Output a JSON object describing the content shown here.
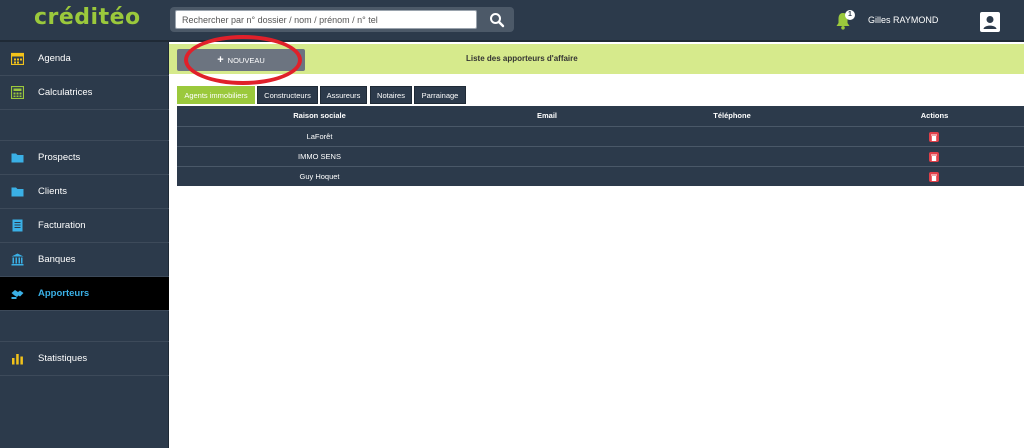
{
  "header": {
    "logo": "créditéo",
    "search_placeholder": "Rechercher par n° dossier / nom / prénom / n° tel",
    "notification_count": "1",
    "username": "Gilles RAYMOND"
  },
  "sidebar": {
    "items": [
      {
        "label": "Agenda",
        "icon": "calendar-icon"
      },
      {
        "label": "Calculatrices",
        "icon": "calculator-icon"
      },
      {
        "label": "Prospects",
        "icon": "folder-icon"
      },
      {
        "label": "Clients",
        "icon": "folder-icon"
      },
      {
        "label": "Facturation",
        "icon": "invoice-icon"
      },
      {
        "label": "Banques",
        "icon": "bank-icon"
      },
      {
        "label": "Apporteurs",
        "icon": "handshake-icon",
        "active": true
      },
      {
        "label": "Statistiques",
        "icon": "bar-chart-icon"
      }
    ]
  },
  "toolbar": {
    "new_label": "NOUVEAU",
    "title": "Liste des apporteurs d'affaire"
  },
  "tabs": [
    {
      "label": "Agents immobiliers",
      "active": true
    },
    {
      "label": "Constructeurs"
    },
    {
      "label": "Assureurs"
    },
    {
      "label": "Notaires"
    },
    {
      "label": "Parrainage"
    }
  ],
  "table": {
    "columns": [
      "Raison sociale",
      "Email",
      "Téléphone",
      "Actions"
    ],
    "rows": [
      {
        "raison_sociale": "LaForêt",
        "email": "",
        "telephone": ""
      },
      {
        "raison_sociale": "IMMO SENS",
        "email": "",
        "telephone": ""
      },
      {
        "raison_sociale": "Guy Hoquet",
        "email": "",
        "telephone": ""
      }
    ]
  },
  "colors": {
    "header_bg": "#2c3a4b",
    "accent_green": "#9bc93c",
    "toolbar_bg": "#d6ea8c",
    "active_link": "#3ab0e6",
    "delete_red": "#e0404a",
    "annotation_ring": "#e0202a"
  }
}
